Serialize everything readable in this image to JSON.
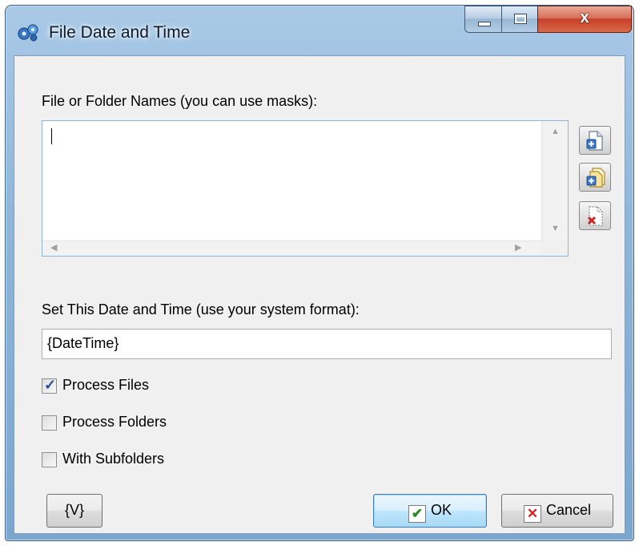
{
  "window": {
    "title": "File Date and Time",
    "icon": "gears-icon",
    "caption_glyphs": {
      "minimize": "",
      "maximize": "",
      "close": "x"
    }
  },
  "names": {
    "label": "File or Folder Names (you can use masks):",
    "value": "",
    "buttons": [
      "add-file-icon",
      "add-folder-icon",
      "remove-item-icon"
    ]
  },
  "datetime": {
    "label": "Set This Date and Time (use your system format):",
    "value": "{DateTime}"
  },
  "options": {
    "process_files": {
      "label": "Process Files",
      "checked": true
    },
    "process_folders": {
      "label": "Process Folders",
      "checked": false
    },
    "with_subfolders": {
      "label": "With Subfolders",
      "checked": false
    }
  },
  "footer": {
    "variables_label": "{V}",
    "ok_label": "OK",
    "cancel_label": "Cancel"
  },
  "colors": {
    "accent": "#3c7fb1",
    "ok_check": "#2a8a2a",
    "cancel_x": "#d42222"
  }
}
